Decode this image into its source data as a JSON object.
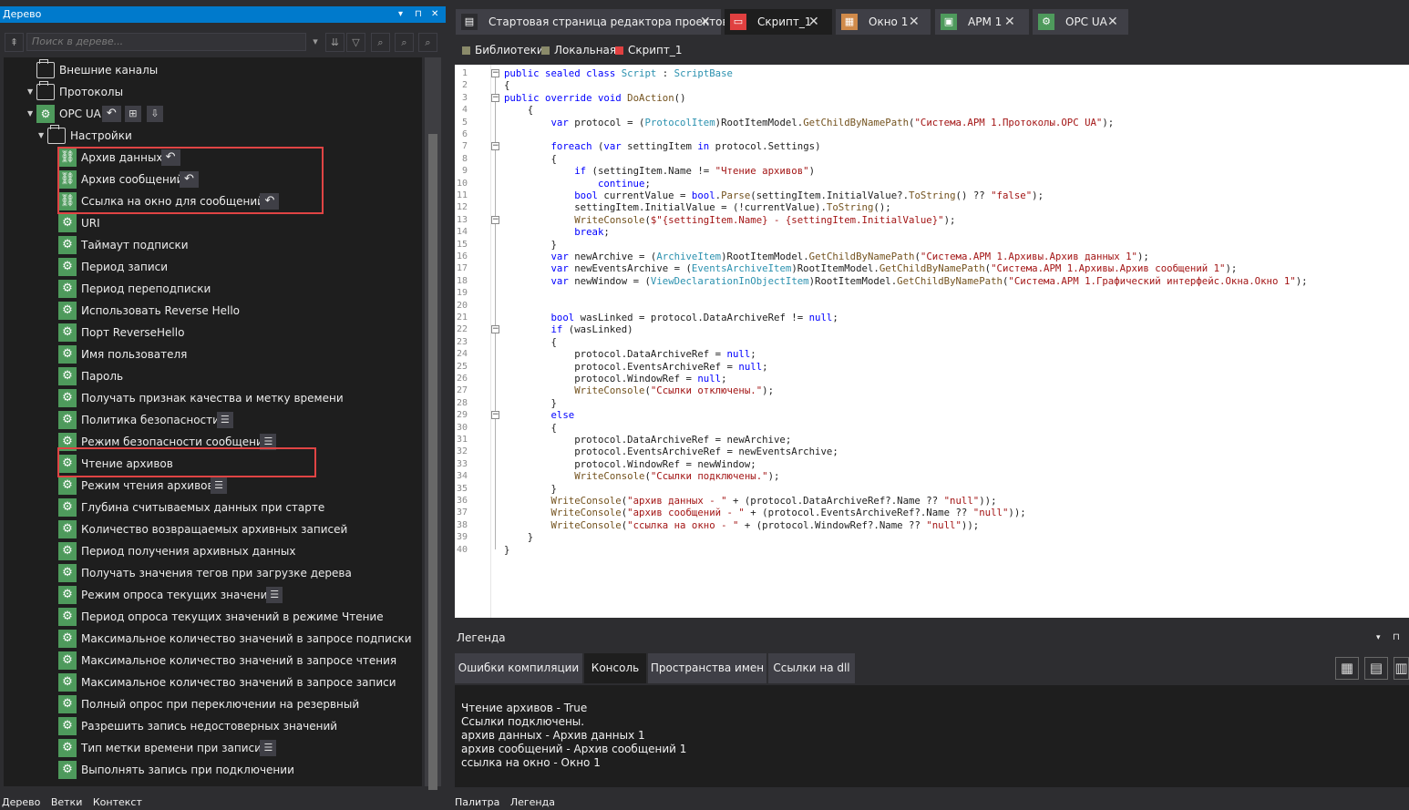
{
  "left_panel": {
    "title": "Дерево",
    "title_controls": [
      "▾",
      "⊓",
      "✕"
    ],
    "search_placeholder": "Поиск в дереве...",
    "bottom_tabs": [
      "Дерево",
      "Ветки",
      "Контекст"
    ]
  },
  "tree": {
    "items": [
      {
        "label": "Внешние каналы",
        "icon": "folder-icon"
      },
      {
        "label": "Протоколы",
        "icon": "folder-icon"
      },
      {
        "label": "OPC UA",
        "icon": "protocol-icon"
      },
      {
        "label": "Настройки",
        "icon": "folder-icon"
      },
      {
        "label": "Архив данных",
        "icon": "link-setting-icon"
      },
      {
        "label": "Архив сообщений",
        "icon": "link-setting-icon"
      },
      {
        "label": "Ссылка на окно для сообщений",
        "icon": "link-setting-icon"
      },
      {
        "label": "URI",
        "icon": "gear-icon"
      },
      {
        "label": "Таймаут подписки",
        "icon": "gear-icon"
      },
      {
        "label": "Период записи",
        "icon": "gear-icon"
      },
      {
        "label": "Период переподписки",
        "icon": "gear-icon"
      },
      {
        "label": "Использовать Reverse Hello",
        "icon": "gear-icon"
      },
      {
        "label": "Порт ReverseHello",
        "icon": "gear-icon"
      },
      {
        "label": "Имя пользователя",
        "icon": "gear-icon"
      },
      {
        "label": "Пароль",
        "icon": "gear-icon"
      },
      {
        "label": "Получать признак качества и метку времени",
        "icon": "gear-icon"
      },
      {
        "label": "Политика безопасности",
        "icon": "gear-icon"
      },
      {
        "label": "Режим безопасности сообщений",
        "icon": "gear-icon"
      },
      {
        "label": "Чтение архивов",
        "icon": "gear-icon"
      },
      {
        "label": "Режим чтения архивов",
        "icon": "gear-icon"
      },
      {
        "label": "Глубина считываемых данных при старте",
        "icon": "gear-icon"
      },
      {
        "label": "Количество возвращаемых архивных записей",
        "icon": "gear-icon"
      },
      {
        "label": "Период получения архивных данных",
        "icon": "gear-icon"
      },
      {
        "label": "Получать значения тегов при загрузке дерева",
        "icon": "gear-icon"
      },
      {
        "label": "Режим опроса текущих значений",
        "icon": "gear-icon"
      },
      {
        "label": "Период опроса текущих значений в режиме Чтение",
        "icon": "gear-icon"
      },
      {
        "label": "Максимальное количество значений в запросе подписки",
        "icon": "gear-icon"
      },
      {
        "label": "Максимальное количество значений в запросе чтения",
        "icon": "gear-icon"
      },
      {
        "label": "Максимальное количество значений в запросе записи",
        "icon": "gear-icon"
      },
      {
        "label": "Полный опрос при переключении на резервный",
        "icon": "gear-icon"
      },
      {
        "label": "Разрешить запись недостоверных значений",
        "icon": "gear-icon"
      },
      {
        "label": "Тип метки времени при записи",
        "icon": "gear-icon"
      },
      {
        "label": "Выполнять запись при подключении",
        "icon": "gear-icon"
      }
    ]
  },
  "doc_tabs": [
    {
      "label": "Стартовая страница редактора проектов",
      "icon": "page-icon",
      "color": "#3f3f46"
    },
    {
      "label": "Скрипт_1",
      "icon": "script-icon",
      "color": "#e04040"
    },
    {
      "label": "Окно 1",
      "icon": "window-icon",
      "color": "#d08a4a"
    },
    {
      "label": "АРМ 1",
      "icon": "workstation-icon",
      "color": "#4e9a5c"
    },
    {
      "label": "OPC UA",
      "icon": "protocol-icon",
      "color": "#4e9a5c"
    }
  ],
  "breadcrumb": [
    {
      "label": "Библиотеки",
      "color": "#8a8a6a"
    },
    {
      "label": "Локальная",
      "color": "#8a8a6a"
    },
    {
      "label": "Скрипт_1",
      "color": "#e04040"
    }
  ],
  "code_lines": [
    "public sealed class Script : ScriptBase",
    "{",
    "public override void DoAction()",
    "    {",
    "        var protocol = (ProtocolItem)RootItemModel.GetChildByNamePath(\"Система.АРМ 1.Протоколы.OPC UA\");",
    "",
    "        foreach (var settingItem in protocol.Settings)",
    "        {",
    "            if (settingItem.Name != \"Чтение архивов\")",
    "                continue;",
    "            bool currentValue = bool.Parse(settingItem.InitialValue?.ToString() ?? \"false\");",
    "            settingItem.InitialValue = (!currentValue).ToString();",
    "            WriteConsole($\"{settingItem.Name} - {settingItem.InitialValue}\");",
    "            break;",
    "        }",
    "        var newArchive = (ArchiveItem)RootItemModel.GetChildByNamePath(\"Система.АРМ 1.Архивы.Архив данных 1\");",
    "        var newEventsArchive = (EventsArchiveItem)RootItemModel.GetChildByNamePath(\"Система.АРМ 1.Архивы.Архив сообщений 1\");",
    "        var newWindow = (ViewDeclarationInObjectItem)RootItemModel.GetChildByNamePath(\"Система.АРМ 1.Графический интерфейс.Окна.Окно 1\");",
    "",
    "",
    "        bool wasLinked = protocol.DataArchiveRef != null;",
    "        if (wasLinked)",
    "        {",
    "            protocol.DataArchiveRef = null;",
    "            protocol.EventsArchiveRef = null;",
    "            protocol.WindowRef = null;",
    "            WriteConsole(\"Ссылки отключены.\");",
    "        }",
    "        else",
    "        {",
    "            protocol.DataArchiveRef = newArchive;",
    "            protocol.EventsArchiveRef = newEventsArchive;",
    "            protocol.WindowRef = newWindow;",
    "            WriteConsole(\"Ссылки подключены.\");",
    "        }",
    "        WriteConsole(\"архив данных - \" + (protocol.DataArchiveRef?.Name ?? \"null\"));",
    "        WriteConsole(\"архив сообщений - \" + (protocol.EventsArchiveRef?.Name ?? \"null\"));",
    "        WriteConsole(\"ссылка на окно - \" + (protocol.WindowRef?.Name ?? \"null\"));",
    "    }",
    "}"
  ],
  "legend": {
    "title": "Легенда",
    "tabs": [
      "Ошибки компиляции",
      "Консоль",
      "Пространства имен",
      "Ссылки на dll"
    ],
    "active_tab": "Консоль",
    "console_lines": [
      "Чтение архивов - True",
      "Ссылки подключены.",
      "архив данных - Архив данных 1",
      "архив сообщений - Архив сообщений 1",
      "ссылка на окно - Окно 1"
    ]
  },
  "right_bottom_tabs": [
    "Палитра",
    "Легенда"
  ]
}
